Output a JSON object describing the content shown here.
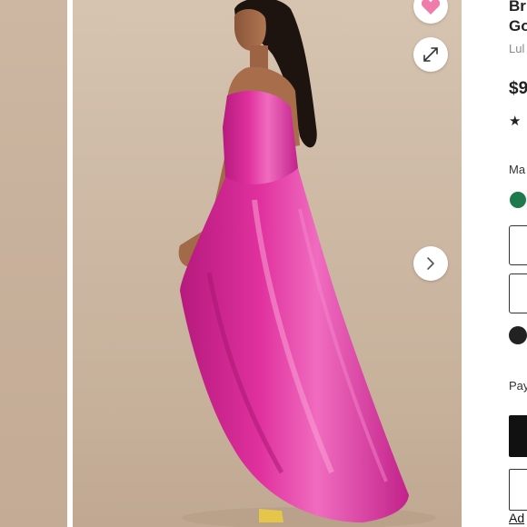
{
  "gallery": {
    "thumbnail_alt": "",
    "next_label": "",
    "expand_label": ""
  },
  "product": {
    "title_line1": "Br",
    "title_line2": "Go",
    "brand": "Lul",
    "price": "$9",
    "rating_stars": "★",
    "color_label": "Ma",
    "payment_label": "Pay",
    "add_link": "Ad"
  },
  "colors": {
    "dress": "#e0319e",
    "swatch_selected": "#1e7a4c",
    "favorite_heart": "#f07cab",
    "photo_background": "#cdb9a4"
  },
  "icons": {
    "favorite": "heart-icon",
    "expand": "expand-arrows-icon",
    "next": "chevron-right-icon",
    "shipping": "shipping-icon",
    "rating": "star-icon"
  }
}
